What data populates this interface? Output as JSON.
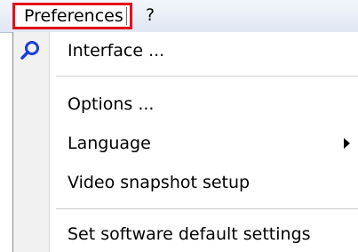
{
  "menubar": {
    "preferences_label": "Preferences",
    "help_label": "?"
  },
  "menu": {
    "items": [
      {
        "label": "Interface ...",
        "icon": "magnifier-icon"
      },
      {
        "label": "Options ..."
      },
      {
        "label": "Language",
        "has_submenu": true
      },
      {
        "label": "Video snapshot setup"
      },
      {
        "label": "Set software default settings"
      }
    ]
  },
  "colors": {
    "highlight_border": "#e3101a",
    "icon_blue": "#1a3fd8"
  }
}
